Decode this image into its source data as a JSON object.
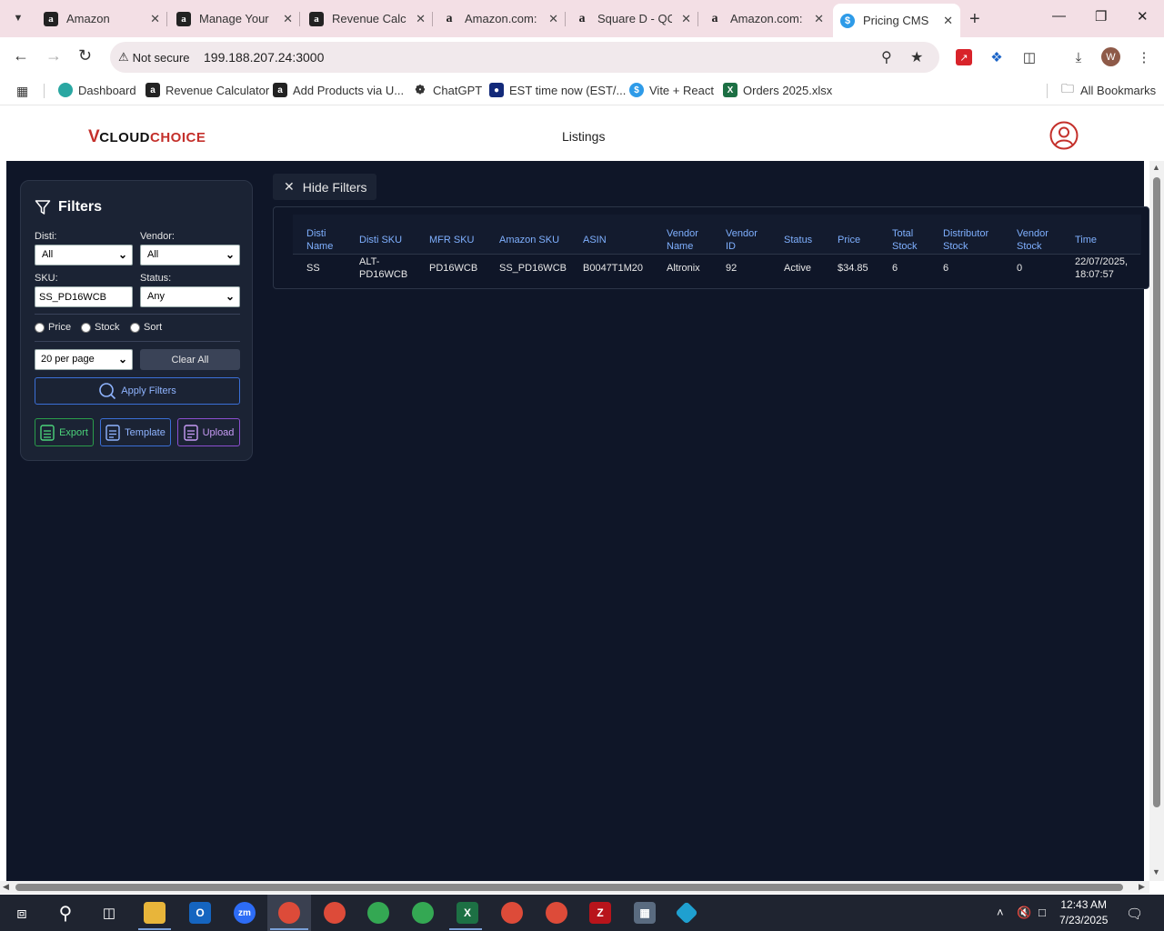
{
  "browser": {
    "tabs": [
      {
        "title": "Amazon",
        "icon": "amazon-a-icon"
      },
      {
        "title": "Manage Your",
        "icon": "amazon-a-icon"
      },
      {
        "title": "Revenue Calc",
        "icon": "amazon-a-icon"
      },
      {
        "title": "Amazon.com:",
        "icon": "amazon-smile-icon"
      },
      {
        "title": "Square D - QC",
        "icon": "amazon-smile-icon"
      },
      {
        "title": "Amazon.com:",
        "icon": "amazon-smile-icon"
      },
      {
        "title": "Pricing CMS",
        "icon": "dollar-icon"
      }
    ],
    "security_label": "Not secure",
    "url": "199.188.207.24:3000",
    "profile_initial": "W",
    "bookmarks": [
      {
        "label": "Dashboard"
      },
      {
        "label": "Revenue Calculator"
      },
      {
        "label": "Add Products via U..."
      },
      {
        "label": "ChatGPT"
      },
      {
        "label": "EST time now (EST/..."
      },
      {
        "label": "Vite + React"
      },
      {
        "label": "Orders 2025.xlsx"
      }
    ],
    "all_bookmarks": "All Bookmarks"
  },
  "app": {
    "logo_v": "V",
    "logo_cloud": "CLOUD",
    "logo_choice": "CHOICE",
    "nav_listings": "Listings",
    "colors": {
      "background": "#0f1628",
      "panel": "#1b2334",
      "header_text": "#7fb0ff",
      "brand": "#c4302b"
    }
  },
  "filters": {
    "title": "Filters",
    "disti_label": "Disti:",
    "disti_value": "All",
    "vendor_label": "Vendor:",
    "vendor_value": "All",
    "sku_label": "SKU:",
    "sku_value": "SS_PD16WCB",
    "status_label": "Status:",
    "status_value": "Any",
    "radio_price": "Price",
    "radio_stock": "Stock",
    "radio_sort": "Sort",
    "per_page_value": "20 per page",
    "clear_all": "Clear All",
    "apply": "Apply Filters",
    "export": "Export",
    "template": "Template",
    "upload": "Upload"
  },
  "hide_filters": "Hide Filters",
  "table": {
    "headers": {
      "disti_name": [
        "Disti",
        "Name"
      ],
      "disti_sku": "Disti SKU",
      "mfr_sku": "MFR SKU",
      "amazon_sku": "Amazon SKU",
      "asin": "ASIN",
      "vendor_name": [
        "Vendor",
        "Name"
      ],
      "vendor_id": [
        "Vendor",
        "ID"
      ],
      "status": "Status",
      "price": "Price",
      "total_stock": [
        "Total",
        "Stock"
      ],
      "distributor_stock": [
        "Distributor",
        "Stock"
      ],
      "vendor_stock": [
        "Vendor",
        "Stock"
      ],
      "time": "Time"
    },
    "rows": [
      {
        "disti_name": "SS",
        "disti_sku": [
          "ALT-",
          "PD16WCB"
        ],
        "mfr_sku": "PD16WCB",
        "amazon_sku": "SS_PD16WCB",
        "asin": "B0047T1M20",
        "vendor_name": "Altronix",
        "vendor_id": "92",
        "status": "Active",
        "price": "$34.85",
        "total_stock": "6",
        "distributor_stock": "6",
        "vendor_stock": "0",
        "time": [
          "22/07/2025,",
          "18:07:57"
        ]
      }
    ]
  },
  "taskbar": {
    "time": "12:43 AM",
    "date": "7/23/2025"
  }
}
